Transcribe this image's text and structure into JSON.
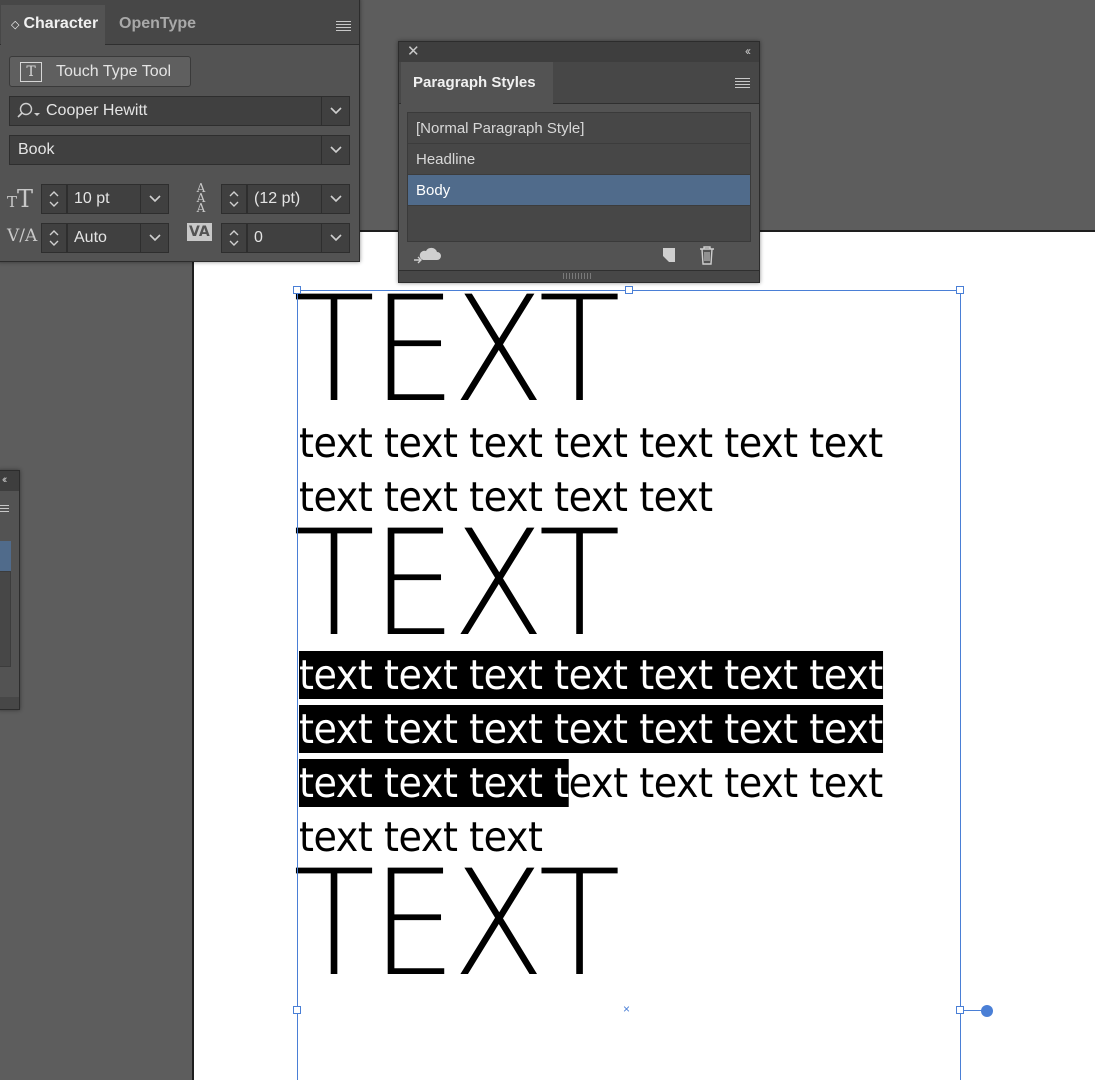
{
  "character_panel": {
    "tabs": [
      "Character",
      "OpenType"
    ],
    "touch_type_label": "Touch Type Tool",
    "font_family": "Cooper Hewitt",
    "font_style": "Book",
    "font_size": "10 pt",
    "leading": "(12 pt)",
    "kerning": "Auto",
    "tracking": "0"
  },
  "paragraph_styles_panel": {
    "title": "Paragraph Styles",
    "styles": [
      "[Normal Paragraph Style]",
      "Headline",
      "Body"
    ],
    "selected_style": "Body"
  },
  "document": {
    "headline": "TEXT",
    "body_lines_1": [
      "text text text text text text text",
      "text text text text text"
    ],
    "body_lines_2": [
      {
        "selected": "text text text text text text text",
        "rest": ""
      },
      {
        "selected": "text text text text text text text",
        "rest": ""
      },
      {
        "selected": "text text text t",
        "rest": "ext text text text"
      },
      {
        "selected": "",
        "rest": "text text text"
      }
    ]
  },
  "colors": {
    "panel_bg": "#535353",
    "selection": "#506b8b",
    "frame": "#4a7fd6"
  }
}
